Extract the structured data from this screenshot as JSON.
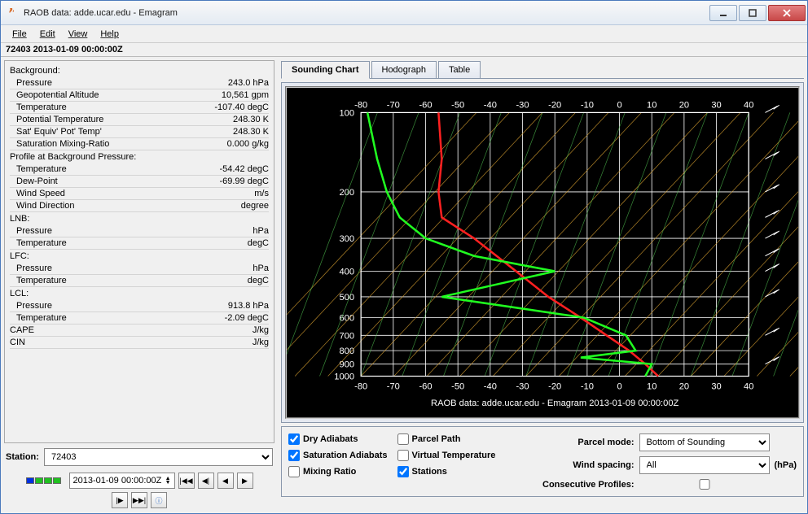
{
  "window": {
    "title": "RAOB data: adde.ucar.edu - Emagram"
  },
  "menubar": [
    "File",
    "Edit",
    "View",
    "Help"
  ],
  "station_line": "72403 2013-01-09 00:00:00Z",
  "params": {
    "background": {
      "label": "Background:",
      "rows": [
        [
          "Pressure",
          "243.0 hPa"
        ],
        [
          "Geopotential Altitude",
          "10,561 gpm"
        ],
        [
          "Temperature",
          "-107.40 degC"
        ],
        [
          "Potential Temperature",
          "248.30 K"
        ],
        [
          "Sat' Equiv' Pot' Temp'",
          "248.30 K"
        ],
        [
          "Saturation Mixing-Ratio",
          "0.000 g/kg"
        ]
      ]
    },
    "profile": {
      "label": "Profile at Background Pressure:",
      "rows": [
        [
          "Temperature",
          "-54.42 degC"
        ],
        [
          "Dew-Point",
          "-69.99 degC"
        ],
        [
          "Wind Speed",
          "m/s"
        ],
        [
          "Wind Direction",
          "degree"
        ]
      ]
    },
    "lnb": {
      "label": "LNB:",
      "rows": [
        [
          "Pressure",
          "hPa"
        ],
        [
          "Temperature",
          "degC"
        ]
      ]
    },
    "lfc": {
      "label": "LFC:",
      "rows": [
        [
          "Pressure",
          "hPa"
        ],
        [
          "Temperature",
          "degC"
        ]
      ]
    },
    "lcl": {
      "label": "LCL:",
      "rows": [
        [
          "Pressure",
          "913.8 hPa"
        ],
        [
          "Temperature",
          "-2.09 degC"
        ]
      ]
    },
    "misc": {
      "rows": [
        [
          "CAPE",
          "J/kg"
        ],
        [
          "CIN",
          "J/kg"
        ]
      ]
    }
  },
  "station_picker": {
    "label": "Station:",
    "value": "72403"
  },
  "playback": {
    "timestamp": "2013-01-09 00:00:00Z",
    "prog_colors": [
      "#0030e0",
      "#20c020",
      "#20c020",
      "#20c020"
    ]
  },
  "tabs": {
    "items": [
      "Sounding Chart",
      "Hodograph",
      "Table"
    ],
    "active": 0
  },
  "chart_data": {
    "type": "sounding",
    "footer": "RAOB data: adde.ucar.edu - Emagram 2013-01-09 00:00:00Z",
    "x_ticks": [
      -80,
      -70,
      -60,
      -50,
      -40,
      -30,
      -20,
      -10,
      0,
      10,
      20,
      30,
      40
    ],
    "y_ticks": [
      100,
      200,
      300,
      400,
      500,
      600,
      700,
      800,
      900,
      1000
    ],
    "ylim": [
      1000,
      100
    ],
    "series": [
      {
        "name": "Temperature",
        "color": "#ff2020",
        "points": [
          [
            -56,
            100
          ],
          [
            -55,
            150
          ],
          [
            -56,
            200
          ],
          [
            -55,
            250
          ],
          [
            -45,
            300
          ],
          [
            -32,
            400
          ],
          [
            -22,
            500
          ],
          [
            -12,
            600
          ],
          [
            -4,
            700
          ],
          [
            3,
            800
          ],
          [
            8,
            900
          ],
          [
            12,
            1000
          ]
        ]
      },
      {
        "name": "Dew-Point",
        "color": "#20ff20",
        "points": [
          [
            -78,
            100
          ],
          [
            -75,
            150
          ],
          [
            -72,
            200
          ],
          [
            -68,
            250
          ],
          [
            -60,
            300
          ],
          [
            -45,
            350
          ],
          [
            -20,
            400
          ],
          [
            -55,
            500
          ],
          [
            -11,
            600
          ],
          [
            2,
            700
          ],
          [
            5,
            800
          ],
          [
            -12,
            850
          ],
          [
            10,
            900
          ],
          [
            8,
            1000
          ]
        ]
      }
    ]
  },
  "options": {
    "checks_left": [
      {
        "label": "Dry Adiabats",
        "checked": true
      },
      {
        "label": "Saturation Adiabats",
        "checked": true
      },
      {
        "label": "Mixing Ratio",
        "checked": false
      }
    ],
    "checks_right": [
      {
        "label": "Parcel Path",
        "checked": false
      },
      {
        "label": "Virtual Temperature",
        "checked": false
      },
      {
        "label": "Stations",
        "checked": true
      }
    ],
    "parcel_mode": {
      "label": "Parcel mode:",
      "value": "Bottom of Sounding"
    },
    "wind_spacing": {
      "label": "Wind spacing:",
      "value": "All",
      "unit": "(hPa)"
    },
    "consecutive": {
      "label": "Consecutive Profiles:",
      "checked": false
    }
  }
}
